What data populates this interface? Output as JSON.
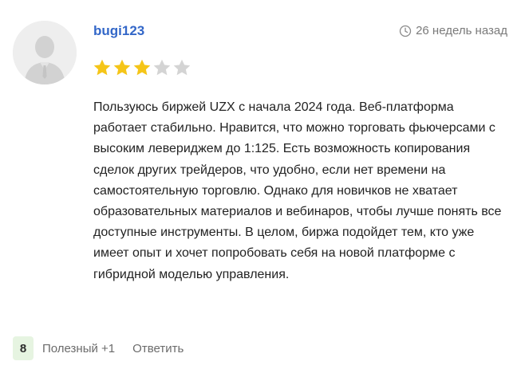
{
  "review": {
    "username": "bugi123",
    "time_ago": "26 недель назад",
    "time_icon": "clock-icon",
    "rating": 3,
    "max_rating": 5,
    "star_color_filled": "#f5c518",
    "star_color_empty": "#d4d4d4",
    "text": "Пользуюсь биржей UZX с начала 2024 года. Веб-платформа работает стабильно. Нравится, что можно торговать фьючерсами с высоким левериджем до 1:125. Есть возможность копирования сделок других трейдеров, что удобно, если нет времени на самостоятельную торговлю. Однако для новичков не хватает образовательных материалов и вебинаров, чтобы лучше понять все доступные инструменты. В целом, биржа подойдет тем, кто уже имеет опыт и хочет попробовать себя на новой платформе с гибридной моделью управления.",
    "avatar_icon": "default-user-avatar-icon"
  },
  "footer": {
    "helpful_count": "8",
    "helpful_label": "Полезный +1",
    "reply_label": "Ответить",
    "helpful_badge_color": "#e6f4e1"
  },
  "colors": {
    "username": "#3367c8",
    "muted_text": "#7a7a7a",
    "body_text": "#222222"
  }
}
